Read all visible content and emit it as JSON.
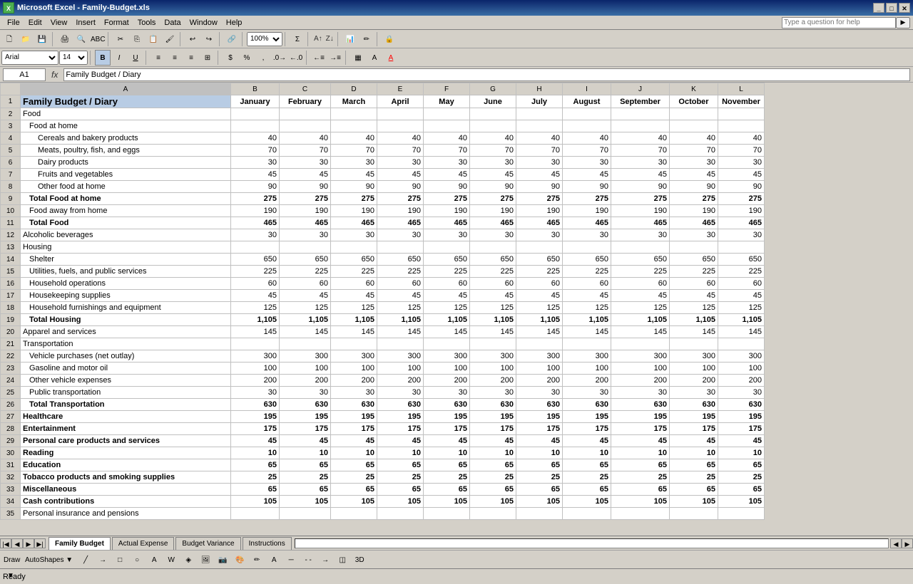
{
  "titleBar": {
    "title": "Microsoft Excel - Family-Budget.xls",
    "icon": "X"
  },
  "menuBar": {
    "items": [
      "File",
      "Edit",
      "View",
      "Insert",
      "Format",
      "Tools",
      "Data",
      "Window",
      "Help"
    ],
    "helpPlaceholder": "Type a question for help"
  },
  "formulaBar": {
    "cellRef": "A1",
    "formula": "Family Budget / Diary"
  },
  "columns": {
    "headers": [
      "",
      "A",
      "B",
      "C",
      "D",
      "E",
      "F",
      "G",
      "H",
      "I",
      "J",
      "K",
      "L"
    ]
  },
  "colLabels": {
    "A": "A",
    "B": "January",
    "C": "February",
    "D": "March",
    "E": "April",
    "F": "May",
    "G": "June",
    "H": "July",
    "I": "August",
    "J": "September",
    "K": "October",
    "L": "November"
  },
  "rows": [
    {
      "row": "1",
      "a": "Family Budget / Diary",
      "b": "January",
      "c": "February",
      "d": "March",
      "e": "April",
      "f": "May",
      "g": "June",
      "h": "July",
      "i": "August",
      "j": "September",
      "k": "October",
      "l": "November"
    },
    {
      "row": "2",
      "a": "Food"
    },
    {
      "row": "3",
      "a": "   Food at home"
    },
    {
      "row": "4",
      "a": "      Cereals and bakery products",
      "b": "40",
      "c": "40",
      "d": "40",
      "e": "40",
      "f": "40",
      "g": "40",
      "h": "40",
      "i": "40",
      "j": "40",
      "k": "40",
      "l": "40"
    },
    {
      "row": "5",
      "a": "      Meats, poultry, fish, and eggs",
      "b": "70",
      "c": "70",
      "d": "70",
      "e": "70",
      "f": "70",
      "g": "70",
      "h": "70",
      "i": "70",
      "j": "70",
      "k": "70",
      "l": "70"
    },
    {
      "row": "6",
      "a": "      Dairy products",
      "b": "30",
      "c": "30",
      "d": "30",
      "e": "30",
      "f": "30",
      "g": "30",
      "h": "30",
      "i": "30",
      "j": "30",
      "k": "30",
      "l": "30"
    },
    {
      "row": "7",
      "a": "      Fruits and vegetables",
      "b": "45",
      "c": "45",
      "d": "45",
      "e": "45",
      "f": "45",
      "g": "45",
      "h": "45",
      "i": "45",
      "j": "45",
      "k": "45",
      "l": "45"
    },
    {
      "row": "8",
      "a": "      Other food at home",
      "b": "90",
      "c": "90",
      "d": "90",
      "e": "90",
      "f": "90",
      "g": "90",
      "h": "90",
      "i": "90",
      "j": "90",
      "k": "90",
      "l": "90"
    },
    {
      "row": "9",
      "a": "   Total Food at home",
      "b": "275",
      "c": "275",
      "d": "275",
      "e": "275",
      "f": "275",
      "g": "275",
      "h": "275",
      "i": "275",
      "j": "275",
      "k": "275",
      "l": "275"
    },
    {
      "row": "10",
      "a": "   Food away from home",
      "b": "190",
      "c": "190",
      "d": "190",
      "e": "190",
      "f": "190",
      "g": "190",
      "h": "190",
      "i": "190",
      "j": "190",
      "k": "190",
      "l": "190"
    },
    {
      "row": "11",
      "a": "Total Food",
      "b": "465",
      "c": "465",
      "d": "465",
      "e": "465",
      "f": "465",
      "g": "465",
      "h": "465",
      "i": "465",
      "j": "465",
      "k": "465",
      "l": "465"
    },
    {
      "row": "12",
      "a": "Alcoholic beverages",
      "b": "30",
      "c": "30",
      "d": "30",
      "e": "30",
      "f": "30",
      "g": "30",
      "h": "30",
      "i": "30",
      "j": "30",
      "k": "30",
      "l": "30"
    },
    {
      "row": "13",
      "a": "Housing"
    },
    {
      "row": "14",
      "a": "   Shelter",
      "b": "650",
      "c": "650",
      "d": "650",
      "e": "650",
      "f": "650",
      "g": "650",
      "h": "650",
      "i": "650",
      "j": "650",
      "k": "650",
      "l": "650"
    },
    {
      "row": "15",
      "a": "   Utilities, fuels, and public services",
      "b": "225",
      "c": "225",
      "d": "225",
      "e": "225",
      "f": "225",
      "g": "225",
      "h": "225",
      "i": "225",
      "j": "225",
      "k": "225",
      "l": "225"
    },
    {
      "row": "16",
      "a": "   Household operations",
      "b": "60",
      "c": "60",
      "d": "60",
      "e": "60",
      "f": "60",
      "g": "60",
      "h": "60",
      "i": "60",
      "j": "60",
      "k": "60",
      "l": "60"
    },
    {
      "row": "17",
      "a": "   Housekeeping supplies",
      "b": "45",
      "c": "45",
      "d": "45",
      "e": "45",
      "f": "45",
      "g": "45",
      "h": "45",
      "i": "45",
      "j": "45",
      "k": "45",
      "l": "45"
    },
    {
      "row": "18",
      "a": "   Household furnishings and equipment",
      "b": "125",
      "c": "125",
      "d": "125",
      "e": "125",
      "f": "125",
      "g": "125",
      "h": "125",
      "i": "125",
      "j": "125",
      "k": "125",
      "l": "125"
    },
    {
      "row": "19",
      "a": "Total Housing",
      "b": "1,105",
      "c": "1,105",
      "d": "1,105",
      "e": "1,105",
      "f": "1,105",
      "g": "1,105",
      "h": "1,105",
      "i": "1,105",
      "j": "1,105",
      "k": "1,105",
      "l": "1,105"
    },
    {
      "row": "20",
      "a": "Apparel and services",
      "b": "145",
      "c": "145",
      "d": "145",
      "e": "145",
      "f": "145",
      "g": "145",
      "h": "145",
      "i": "145",
      "j": "145",
      "k": "145",
      "l": "145"
    },
    {
      "row": "21",
      "a": "Transportation"
    },
    {
      "row": "22",
      "a": "   Vehicle purchases (net outlay)",
      "b": "300",
      "c": "300",
      "d": "300",
      "e": "300",
      "f": "300",
      "g": "300",
      "h": "300",
      "i": "300",
      "j": "300",
      "k": "300",
      "l": "300"
    },
    {
      "row": "23",
      "a": "   Gasoline and motor oil",
      "b": "100",
      "c": "100",
      "d": "100",
      "e": "100",
      "f": "100",
      "g": "100",
      "h": "100",
      "i": "100",
      "j": "100",
      "k": "100",
      "l": "100"
    },
    {
      "row": "24",
      "a": "   Other vehicle expenses",
      "b": "200",
      "c": "200",
      "d": "200",
      "e": "200",
      "f": "200",
      "g": "200",
      "h": "200",
      "i": "200",
      "j": "200",
      "k": "200",
      "l": "200"
    },
    {
      "row": "25",
      "a": "   Public transportation",
      "b": "30",
      "c": "30",
      "d": "30",
      "e": "30",
      "f": "30",
      "g": "30",
      "h": "30",
      "i": "30",
      "j": "30",
      "k": "30",
      "l": "30"
    },
    {
      "row": "26",
      "a": "Total Transportation",
      "b": "630",
      "c": "630",
      "d": "630",
      "e": "630",
      "f": "630",
      "g": "630",
      "h": "630",
      "i": "630",
      "j": "630",
      "k": "630",
      "l": "630"
    },
    {
      "row": "27",
      "a": "Healthcare",
      "b": "195",
      "c": "195",
      "d": "195",
      "e": "195",
      "f": "195",
      "g": "195",
      "h": "195",
      "i": "195",
      "j": "195",
      "k": "195",
      "l": "195"
    },
    {
      "row": "28",
      "a": "Entertainment",
      "b": "175",
      "c": "175",
      "d": "175",
      "e": "175",
      "f": "175",
      "g": "175",
      "h": "175",
      "i": "175",
      "j": "175",
      "k": "175",
      "l": "175"
    },
    {
      "row": "29",
      "a": "Personal care products and services",
      "b": "45",
      "c": "45",
      "d": "45",
      "e": "45",
      "f": "45",
      "g": "45",
      "h": "45",
      "i": "45",
      "j": "45",
      "k": "45",
      "l": "45"
    },
    {
      "row": "30",
      "a": "Reading",
      "b": "10",
      "c": "10",
      "d": "10",
      "e": "10",
      "f": "10",
      "g": "10",
      "h": "10",
      "i": "10",
      "j": "10",
      "k": "10",
      "l": "10"
    },
    {
      "row": "31",
      "a": "Education",
      "b": "65",
      "c": "65",
      "d": "65",
      "e": "65",
      "f": "65",
      "g": "65",
      "h": "65",
      "i": "65",
      "j": "65",
      "k": "65",
      "l": "65"
    },
    {
      "row": "32",
      "a": "Tobacco products and smoking supplies",
      "b": "25",
      "c": "25",
      "d": "25",
      "e": "25",
      "f": "25",
      "g": "25",
      "h": "25",
      "i": "25",
      "j": "25",
      "k": "25",
      "l": "25"
    },
    {
      "row": "33",
      "a": "Miscellaneous",
      "b": "65",
      "c": "65",
      "d": "65",
      "e": "65",
      "f": "65",
      "g": "65",
      "h": "65",
      "i": "65",
      "j": "65",
      "k": "65",
      "l": "65"
    },
    {
      "row": "34",
      "a": "Cash contributions",
      "b": "105",
      "c": "105",
      "d": "105",
      "e": "105",
      "f": "105",
      "g": "105",
      "h": "105",
      "i": "105",
      "j": "105",
      "k": "105",
      "l": "105"
    },
    {
      "row": "35",
      "a": "Personal insurance and pensions"
    }
  ],
  "tabs": [
    {
      "label": "Family Budget",
      "active": true
    },
    {
      "label": "Actual Expense",
      "active": false
    },
    {
      "label": "Budget Variance",
      "active": false
    },
    {
      "label": "Instructions",
      "active": false
    }
  ],
  "statusBar": {
    "text": "Ready"
  },
  "drawToolbar": {
    "draw": "Draw ▼",
    "autoshapes": "AutoShapes ▼"
  },
  "boldRows": [
    1,
    9,
    11,
    13,
    19,
    21,
    26,
    27,
    28,
    29,
    30,
    31,
    32,
    33,
    34
  ],
  "sectionRows": [
    2,
    13,
    21
  ],
  "indentRows": [
    3,
    4,
    5,
    6,
    7,
    8,
    10,
    14,
    15,
    16,
    17,
    18,
    22,
    23,
    24,
    25
  ]
}
